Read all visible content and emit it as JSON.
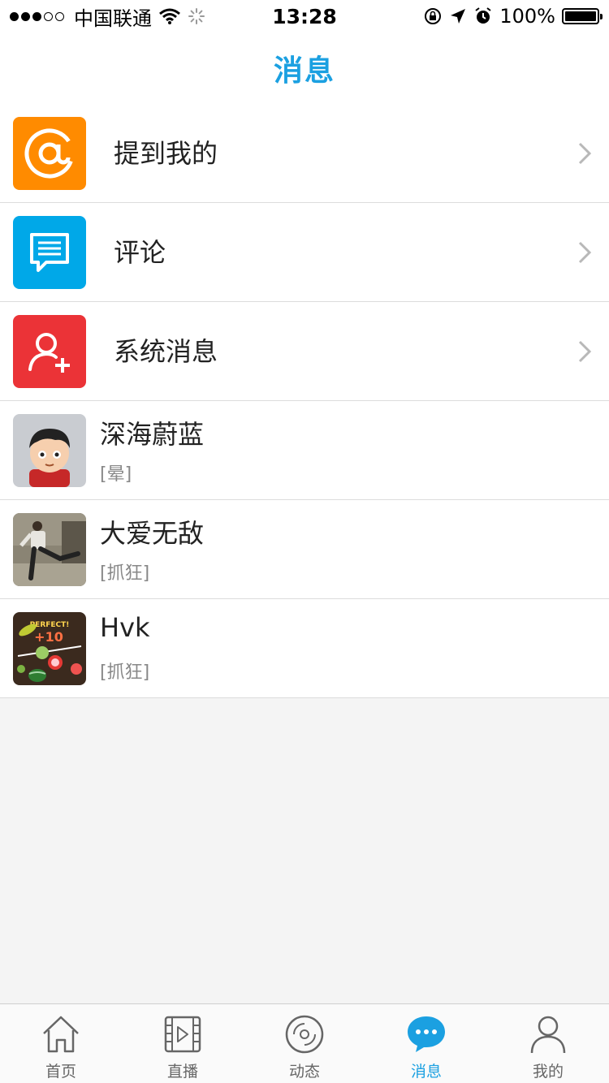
{
  "status": {
    "carrier": "中国联通",
    "time": "13:28",
    "battery": "100%"
  },
  "nav": {
    "title": "消息"
  },
  "menu": [
    {
      "label": "提到我的",
      "icon": "at-icon",
      "color": "#ff8b00"
    },
    {
      "label": "评论",
      "icon": "comment-icon",
      "color": "#00a8e8"
    },
    {
      "label": "系统消息",
      "icon": "add-user-icon",
      "color": "#eb3337"
    }
  ],
  "chats": [
    {
      "name": "深海蔚蓝",
      "preview": "[晕]",
      "avatar": "cartoon-boy-avatar"
    },
    {
      "name": "大爱无敌",
      "preview": "[抓狂]",
      "avatar": "man-kicking-photo-avatar"
    },
    {
      "name": "Hvk",
      "preview": "[抓狂]",
      "avatar": "fruit-ninja-avatar"
    }
  ],
  "avatar_text": {
    "perfect": "PERFECT!",
    "score": "+10"
  },
  "tabs": [
    {
      "label": "首页",
      "icon": "home-icon"
    },
    {
      "label": "直播",
      "icon": "video-icon"
    },
    {
      "label": "动态",
      "icon": "disc-icon"
    },
    {
      "label": "消息",
      "icon": "message-icon",
      "active": true
    },
    {
      "label": "我的",
      "icon": "person-icon"
    }
  ],
  "colors": {
    "accent": "#1ba0e1"
  }
}
